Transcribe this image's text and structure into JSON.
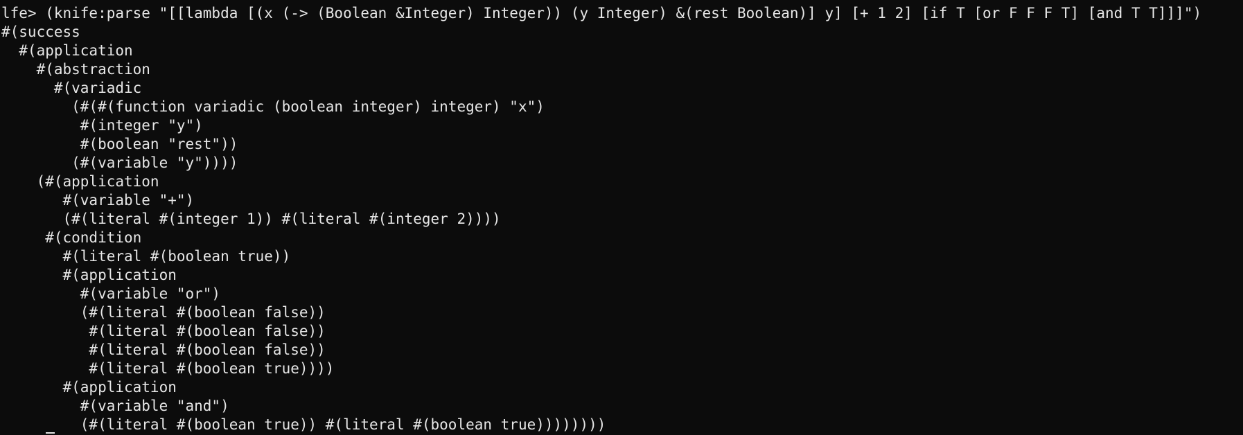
{
  "terminal": {
    "lines": [
      "lfe> (knife:parse \"[[lambda [(x (-> (Boolean &Integer) Integer)) (y Integer) &(rest Boolean)] y] [+ 1 2] [if T [or F F F T] [and T T]]]\")",
      "#(success",
      "  #(application",
      "    #(abstraction",
      "      #(variadic",
      "        (#(#(function variadic (boolean integer) integer) \"x\")",
      "         #(integer \"y\")",
      "         #(boolean \"rest\"))",
      "        (#(variable \"y\"))))",
      "    (#(application",
      "       #(variable \"+\")",
      "       (#(literal #(integer 1)) #(literal #(integer 2))))",
      "     #(condition",
      "       #(literal #(boolean true))",
      "       #(application",
      "         #(variable \"or\")",
      "         (#(literal #(boolean false))",
      "          #(literal #(boolean false))",
      "          #(literal #(boolean false))",
      "          #(literal #(boolean true))))",
      "       #(application",
      "         #(variable \"and\")",
      "         (#(literal #(boolean true)) #(literal #(boolean true))))))))"
    ]
  }
}
